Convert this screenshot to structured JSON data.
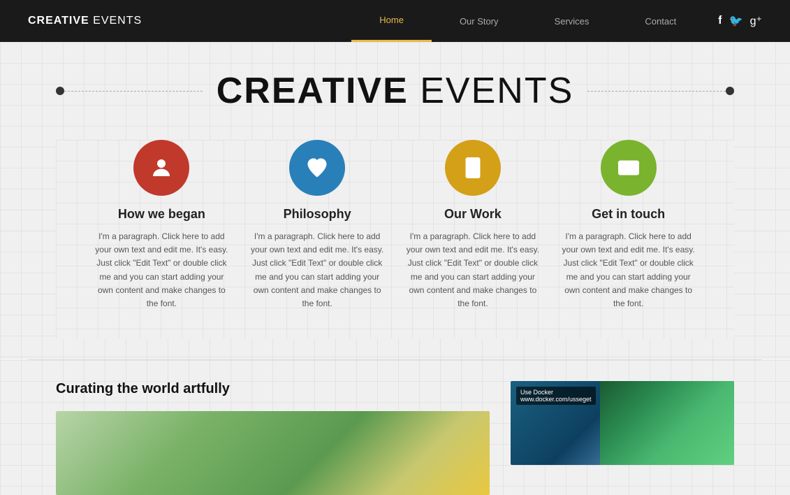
{
  "nav": {
    "logo_bold": "CREATIVE",
    "logo_rest": " EVENTS",
    "links": [
      {
        "label": "Home",
        "active": true
      },
      {
        "label": "Our Story",
        "active": false
      },
      {
        "label": "Services",
        "active": false
      },
      {
        "label": "Contact",
        "active": false
      }
    ],
    "social": [
      "f",
      "t",
      "g+"
    ]
  },
  "hero": {
    "title_bold": "CREATIVE",
    "title_light": " EVENTS"
  },
  "features": [
    {
      "id": "how-we-began",
      "title": "How we began",
      "icon": "person",
      "icon_class": "icon-red",
      "text": "I'm a paragraph. Click here to add your own text and edit me. It's easy. Just click \"Edit Text\" or double click me and you can start adding your own content and make changes to the font."
    },
    {
      "id": "philosophy",
      "title": "Philosophy",
      "icon": "heart",
      "icon_class": "icon-teal",
      "text": "I'm a paragraph. Click here to add your own text and edit me. It's easy. Just click \"Edit Text\" or double click me and you can start adding your own content and make changes to the font."
    },
    {
      "id": "our-work",
      "title": "Our Work",
      "icon": "document",
      "icon_class": "icon-gold",
      "text": "I'm a paragraph. Click here to add your own text and edit me. It's easy. Just click \"Edit Text\" or double click me and you can start adding your own content and make changes to the font."
    },
    {
      "id": "get-in-touch",
      "title": "Get in touch",
      "icon": "envelope",
      "icon_class": "icon-green",
      "text": "I'm a paragraph. Click here to add your own text and edit me. It's easy. Just click \"Edit Text\" or double click me and you can start adding your own content and make changes to the font."
    }
  ],
  "bottom": {
    "title": "Curating the world artfully",
    "docker_badge": "Use Docker\nwww.docker.com/usseget"
  }
}
